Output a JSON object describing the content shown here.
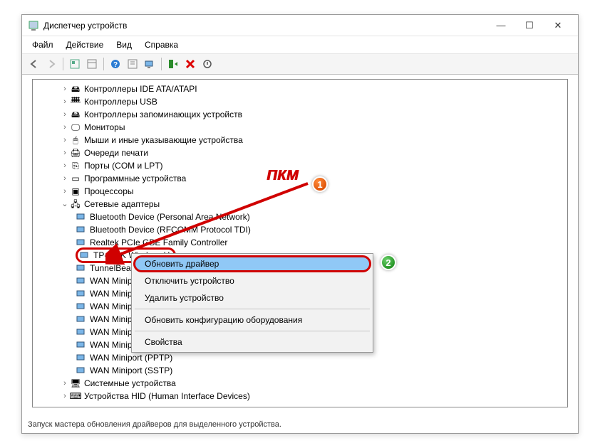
{
  "window": {
    "title": "Диспетчер устройств"
  },
  "menu": {
    "file": "Файл",
    "action": "Действие",
    "view": "Вид",
    "help": "Справка"
  },
  "tree": {
    "ide": "Контроллеры IDE ATA/ATAPI",
    "usb": "Контроллеры USB",
    "storage": "Контроллеры запоминающих устройств",
    "monitors": "Мониторы",
    "mice": "Мыши и иные указывающие устройства",
    "printq": "Очереди печати",
    "ports": "Порты (COM и LPT)",
    "software": "Программные устройства",
    "cpu": "Процессоры",
    "netadapters": "Сетевые адаптеры",
    "net": {
      "bt_pan": "Bluetooth Device (Personal Area Network)",
      "bt_rfcomm": "Bluetooth Device (RFCOMM Protocol TDI)",
      "realtek": "Realtek PCIe GBE Family Controller",
      "tplink": "TP-LINK Wireless U",
      "tunnelbear": "TunnelBear Adapter",
      "wan_ike": "WAN Miniport (IKE",
      "wan_ip": "WAN Miniport (IP)",
      "wan_ipv": "WAN Miniport (IPv",
      "wan_l2t": "WAN Miniport (L2T",
      "wan_net": "WAN Miniport (Net",
      "wan_pppoe": "WAN Miniport (PPPOE)",
      "wan_pptp": "WAN Miniport (PPTP)",
      "wan_sstp": "WAN Miniport (SSTP)"
    },
    "sysdev": "Системные устройства",
    "hid": "Устройства HID (Human Interface Devices)"
  },
  "context_menu": {
    "update": "Обновить драйвер",
    "disable": "Отключить устройство",
    "uninstall": "Удалить устройство",
    "scan": "Обновить конфигурацию оборудования",
    "props": "Свойства"
  },
  "annotations": {
    "pkm": "ПКМ",
    "one": "1",
    "two": "2"
  },
  "statusbar": "Запуск мастера обновления драйверов для выделенного устройства."
}
